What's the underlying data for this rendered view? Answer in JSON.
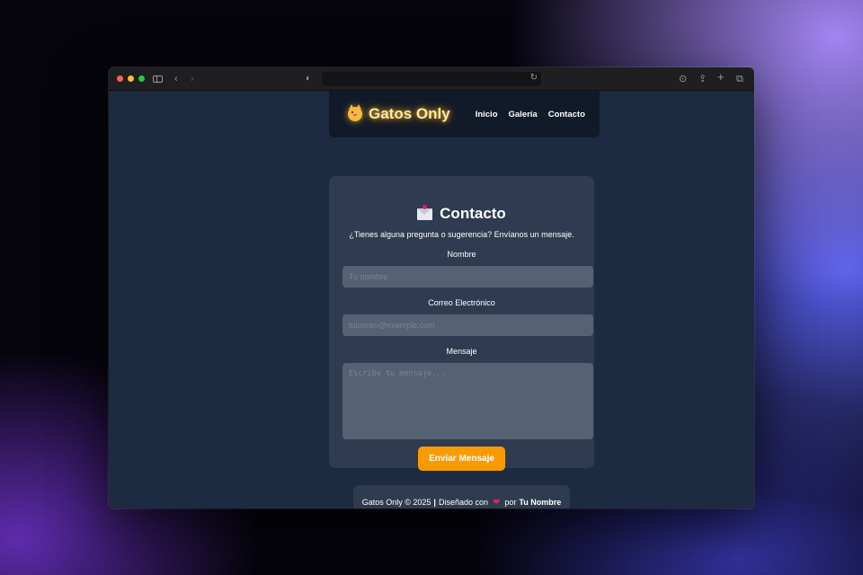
{
  "browser": {
    "url": "",
    "toolbar_icons": [
      "sidebar-icon",
      "back-icon",
      "forward-icon",
      "shield-icon",
      "reload-icon",
      "download-icon",
      "share-icon",
      "new-tab-icon",
      "tabs-icon"
    ]
  },
  "navbar": {
    "brand": "Gatos Only",
    "links": [
      "Inicio",
      "Galería",
      "Contacto"
    ]
  },
  "contact": {
    "title": "Contacto",
    "subtitle": "¿Tienes alguna pregunta o sugerencia? Envíanos un mensaje.",
    "name_label": "Nombre",
    "name_placeholder": "Tu nombre",
    "email_label": "Correo Electrónico",
    "email_placeholder": "tucorreo@example.com",
    "message_label": "Mensaje",
    "message_placeholder": "Escribe tu mensaje...",
    "submit": "Enviar Mensaje"
  },
  "footer": {
    "prefix": "Gatos Only © 2025",
    "separator": "|",
    "designed": "Diseñado con",
    "by": "por",
    "author": "Tu Nombre"
  },
  "colors": {
    "accent": "#f89b00",
    "page_bg": "#1c2a42",
    "card_bg": "#2e3b50",
    "brand_glow": "#ffbe28"
  }
}
